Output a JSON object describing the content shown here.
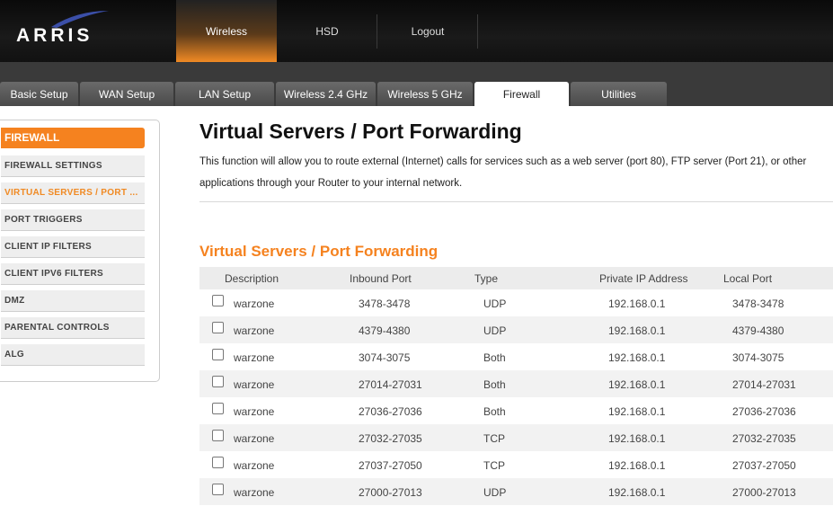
{
  "brand": {
    "name": "ARRIS"
  },
  "topnav": [
    {
      "label": "Wireless",
      "active": true
    },
    {
      "label": "HSD",
      "active": false
    },
    {
      "label": "Logout",
      "active": false
    }
  ],
  "tabs": [
    {
      "label": "Basic Setup"
    },
    {
      "label": "WAN Setup"
    },
    {
      "label": "LAN Setup"
    },
    {
      "label": "Wireless 2.4 GHz"
    },
    {
      "label": "Wireless 5 GHz"
    },
    {
      "label": "Firewall",
      "active": true
    },
    {
      "label": "Utilities"
    }
  ],
  "sidebar": {
    "title": "FIREWALL",
    "items": [
      {
        "label": "FIREWALL SETTINGS"
      },
      {
        "label": "VIRTUAL SERVERS / PORT ...",
        "active": true
      },
      {
        "label": "PORT TRIGGERS"
      },
      {
        "label": "CLIENT IP FILTERS"
      },
      {
        "label": "CLIENT IPV6 FILTERS"
      },
      {
        "label": "DMZ"
      },
      {
        "label": "PARENTAL CONTROLS"
      },
      {
        "label": "ALG"
      }
    ]
  },
  "main": {
    "title": "Virtual Servers / Port Forwarding",
    "description": "This function will allow you to route external (Internet) calls for services such as a web server (port 80), FTP server (Port 21), or other applications through your Router to your internal network.",
    "table_title": "Virtual Servers / Port Forwarding",
    "columns": [
      "Description",
      "Inbound Port",
      "Type",
      "Private IP Address",
      "Local Port"
    ],
    "rows": [
      {
        "description": "warzone",
        "inbound": "3478-3478",
        "type": "UDP",
        "ip": "192.168.0.1",
        "local": "3478-3478"
      },
      {
        "description": "warzone",
        "inbound": "4379-4380",
        "type": "UDP",
        "ip": "192.168.0.1",
        "local": "4379-4380"
      },
      {
        "description": "warzone",
        "inbound": "3074-3075",
        "type": "Both",
        "ip": "192.168.0.1",
        "local": "3074-3075"
      },
      {
        "description": "warzone",
        "inbound": "27014-27031",
        "type": "Both",
        "ip": "192.168.0.1",
        "local": "27014-27031"
      },
      {
        "description": "warzone",
        "inbound": "27036-27036",
        "type": "Both",
        "ip": "192.168.0.1",
        "local": "27036-27036"
      },
      {
        "description": "warzone",
        "inbound": "27032-27035",
        "type": "TCP",
        "ip": "192.168.0.1",
        "local": "27032-27035"
      },
      {
        "description": "warzone",
        "inbound": "27037-27050",
        "type": "TCP",
        "ip": "192.168.0.1",
        "local": "27037-27050"
      },
      {
        "description": "warzone",
        "inbound": "27000-27013",
        "type": "UDP",
        "ip": "192.168.0.1",
        "local": "27000-27013"
      }
    ]
  },
  "colors": {
    "accent": "#f5821f",
    "header": "#111111",
    "tabbar": "#3a3a3a"
  }
}
